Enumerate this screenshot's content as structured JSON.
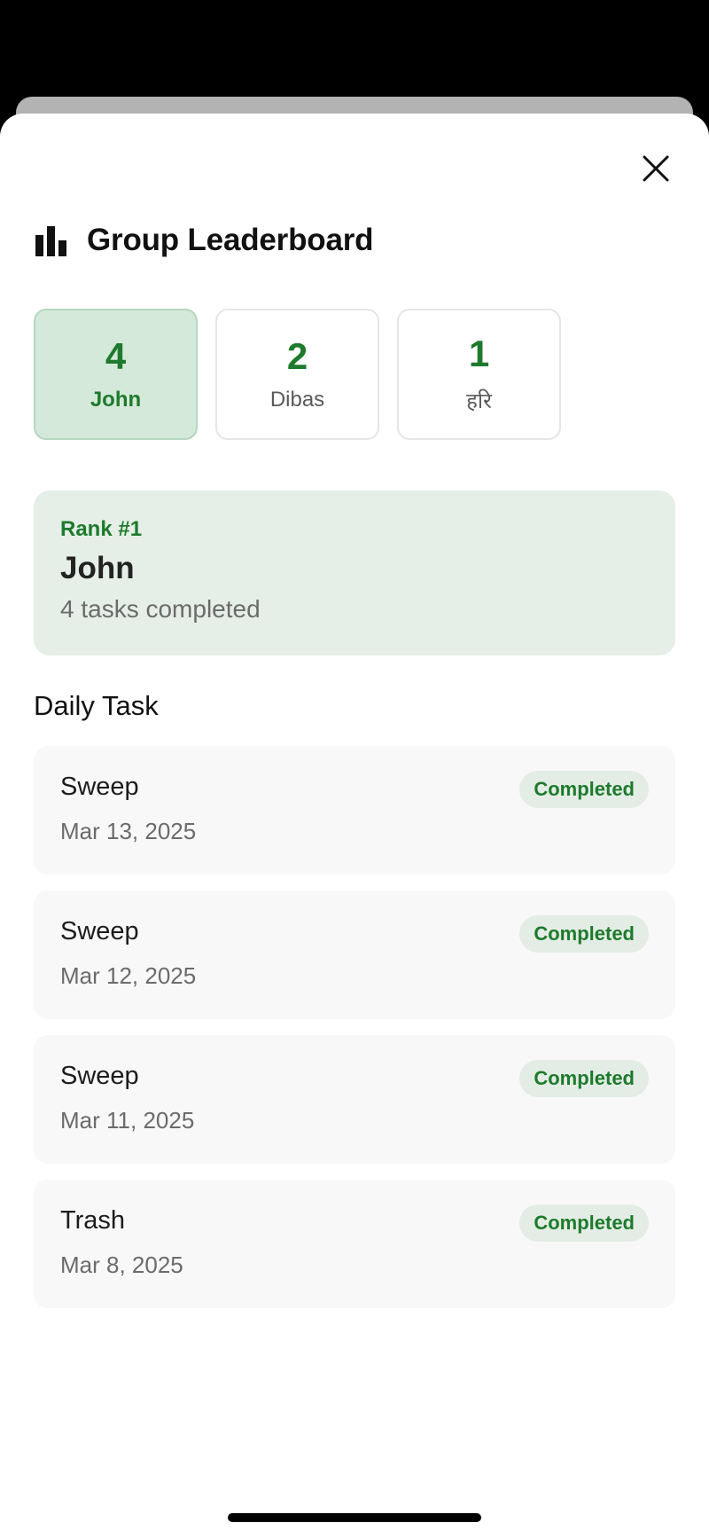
{
  "header": {
    "title": "Group Leaderboard"
  },
  "stats": [
    {
      "score": "4",
      "name": "John"
    },
    {
      "score": "2",
      "name": "Dibas"
    },
    {
      "score": "1",
      "name": "हरि"
    }
  ],
  "selected_member_index": 0,
  "rank_card": {
    "rank": "Rank #1",
    "name": "John",
    "tasks": "4 tasks completed"
  },
  "section": {
    "title": "Daily Task"
  },
  "tasks": [
    {
      "title": "Sweep",
      "date": "Mar 13, 2025",
      "status": "Completed"
    },
    {
      "title": "Sweep",
      "date": "Mar 12, 2025",
      "status": "Completed"
    },
    {
      "title": "Sweep",
      "date": "Mar 11, 2025",
      "status": "Completed"
    },
    {
      "title": "Trash",
      "date": "Mar 8, 2025",
      "status": "Completed"
    }
  ],
  "icons": {
    "close": "close-icon",
    "header": "bar-chart-icon"
  },
  "colors": {
    "accent": "#1e7a2c",
    "active_card": "#d4e9da",
    "rank_card": "#e5efe7",
    "badge": "#e3ede5"
  }
}
